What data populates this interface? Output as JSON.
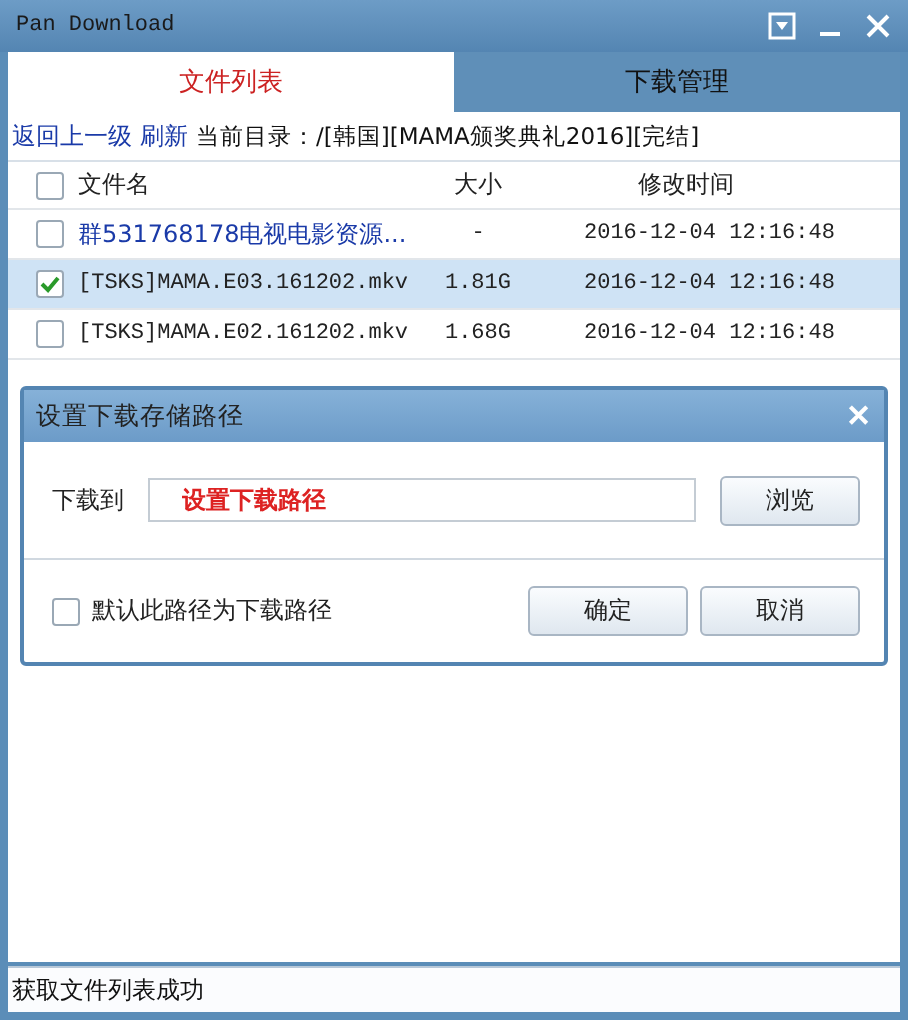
{
  "window": {
    "title": "Pan Download"
  },
  "tabs": [
    {
      "label": "文件列表",
      "selected": true
    },
    {
      "label": "下载管理",
      "selected": false
    }
  ],
  "path_bar": {
    "back_link": "返回上一级",
    "refresh_link": "刷新",
    "current_dir_label": "当前目录：/[韩国][MAMA颁奖典礼2016][完结]"
  },
  "table": {
    "select_all_checked": false,
    "columns": [
      "文件名",
      "大小",
      "修改时间"
    ],
    "rows": [
      {
        "name": "群531768178电视电影资源...",
        "size": "-",
        "modified": "2016-12-04 12:16:48",
        "kind": "folder",
        "checked": false,
        "selected": false
      },
      {
        "name": "[TSKS]MAMA.E03.161202.mkv",
        "size": "1.81G",
        "modified": "2016-12-04 12:16:48",
        "kind": "file",
        "checked": true,
        "selected": true
      },
      {
        "name": "[TSKS]MAMA.E02.161202.mkv",
        "size": "1.68G",
        "modified": "2016-12-04 12:16:48",
        "kind": "file",
        "checked": false,
        "selected": false
      }
    ]
  },
  "dialog": {
    "title": "设置下载存储路径",
    "close": "✕",
    "path_label": "下载到",
    "path_value": "设置下载路径",
    "browse_button": "浏览",
    "default_checkbox": {
      "label": "默认此路径为下载路径",
      "checked": false
    },
    "buttons": [
      "确定",
      "取消"
    ]
  },
  "status_bar": "获取文件列表成功"
}
